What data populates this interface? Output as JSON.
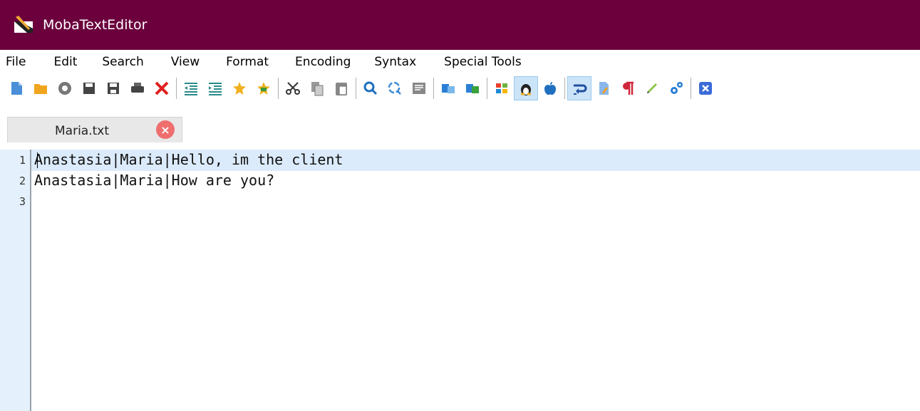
{
  "window": {
    "title": "MobaTextEditor"
  },
  "menu": [
    "File",
    "Edit",
    "Search",
    "View",
    "Format",
    "Encoding",
    "Syntax",
    "Special Tools"
  ],
  "toolbar": {
    "buttons": [
      "new-file-icon",
      "open-folder-icon",
      "reload-icon",
      "save-icon",
      "save-as-icon",
      "print-icon",
      "close-file-icon",
      "|",
      "outdent-icon",
      "indent-icon",
      "bookmark-icon",
      "bookmark-next-icon",
      "|",
      "cut-icon",
      "copy-icon",
      "paste-icon",
      "|",
      "find-icon",
      "replace-icon",
      "goto-line-icon",
      "|",
      "compare-left-icon",
      "compare-right-icon",
      "|",
      "windows-eol-icon",
      "linux-eol-icon",
      "mac-eol-icon",
      "|",
      "word-wrap-icon",
      "highlight-icon",
      "show-whitespace-icon",
      "pen-icon",
      "settings-icon",
      "|",
      "exit-icon"
    ],
    "active": [
      "linux-eol-icon",
      "word-wrap-icon"
    ]
  },
  "tab": {
    "label": "Maria.txt"
  },
  "editor": {
    "line_numbers": [
      "1",
      "2",
      "3"
    ],
    "lines": [
      "Anastasia|Maria|Hello, im the client",
      "Anastasia|Maria|How are you?",
      ""
    ]
  }
}
